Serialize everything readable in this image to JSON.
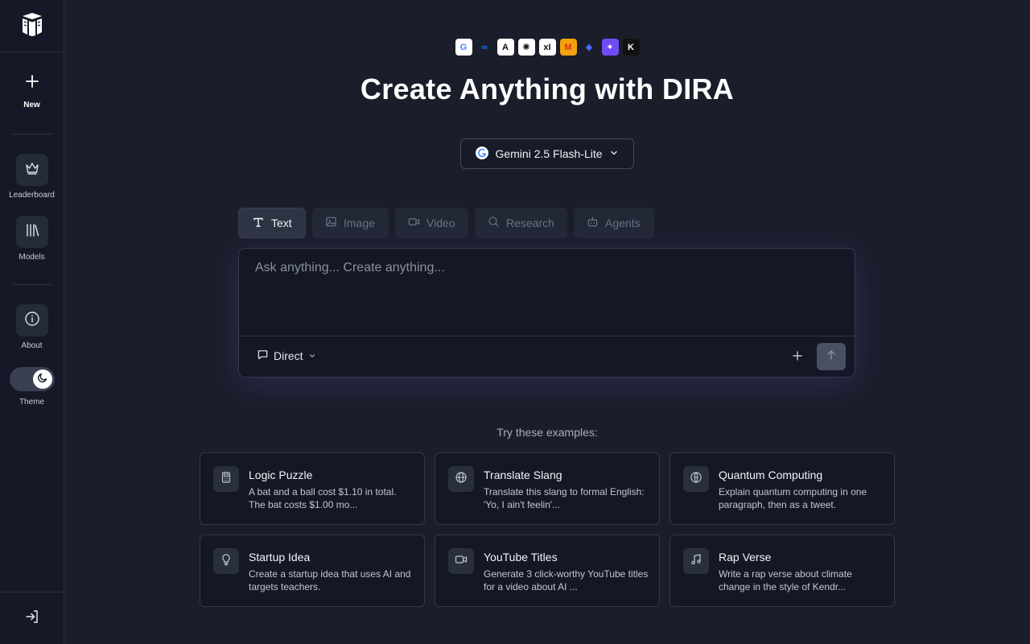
{
  "sidebar": {
    "new_label": "New",
    "leaderboard_label": "Leaderboard",
    "models_label": "Models",
    "about_label": "About",
    "theme_label": "Theme"
  },
  "providers": [
    {
      "name": "google-icon",
      "glyph": "G",
      "bg": "#ffffff",
      "fg": "#4285f4"
    },
    {
      "name": "meta-icon",
      "glyph": "∞",
      "bg": "transparent",
      "fg": "#1877f2"
    },
    {
      "name": "anthropic-icon",
      "glyph": "A",
      "bg": "#ffffff",
      "fg": "#111111"
    },
    {
      "name": "openai-icon",
      "glyph": "✺",
      "bg": "#ffffff",
      "fg": "#111111"
    },
    {
      "name": "xai-icon",
      "glyph": "xI",
      "bg": "#ffffff",
      "fg": "#111111"
    },
    {
      "name": "mistral-icon",
      "glyph": "M",
      "bg": "#f2a20d",
      "fg": "#e0311c"
    },
    {
      "name": "deepseek-icon",
      "glyph": "◆",
      "bg": "transparent",
      "fg": "#4d6bfe"
    },
    {
      "name": "qwen-icon",
      "glyph": "✦",
      "bg": "#6f4cf5",
      "fg": "#ffffff"
    },
    {
      "name": "kimi-icon",
      "glyph": "K",
      "bg": "#111111",
      "fg": "#ffffff"
    }
  ],
  "header": {
    "title": "Create Anything with DIRA"
  },
  "model_selector": {
    "value": "Gemini 2.5 Flash-Lite"
  },
  "tabs": [
    {
      "label": "Text",
      "icon": "text-icon",
      "active": true
    },
    {
      "label": "Image",
      "icon": "image-icon",
      "active": false
    },
    {
      "label": "Video",
      "icon": "video-icon",
      "active": false
    },
    {
      "label": "Research",
      "icon": "search-icon",
      "active": false
    },
    {
      "label": "Agents",
      "icon": "bot-icon",
      "active": false
    }
  ],
  "composer": {
    "placeholder": "Ask anything... Create anything...",
    "mode_label": "Direct"
  },
  "examples": {
    "heading": "Try these examples:",
    "items": [
      {
        "title": "Logic Puzzle",
        "desc": "A bat and a ball cost $1.10 in total. The bat costs $1.00 mo...",
        "icon": "calculator-icon"
      },
      {
        "title": "Translate Slang",
        "desc": "Translate this slang to formal English: 'Yo, I ain't feelin'...",
        "icon": "globe-icon"
      },
      {
        "title": "Quantum Computing",
        "desc": "Explain quantum computing in one paragraph, then as a tweet.",
        "icon": "atom-icon"
      },
      {
        "title": "Startup Idea",
        "desc": "Create a startup idea that uses AI and targets teachers.",
        "icon": "lightbulb-icon"
      },
      {
        "title": "YouTube Titles",
        "desc": "Generate 3 click-worthy YouTube titles for a video about AI ...",
        "icon": "video-icon"
      },
      {
        "title": "Rap Verse",
        "desc": "Write a rap verse about climate change in the style of Kendr...",
        "icon": "music-icon"
      }
    ]
  },
  "colors": {
    "background": "#1a1e2a",
    "sidebar": "#151927",
    "glow": "#6e46c8"
  }
}
